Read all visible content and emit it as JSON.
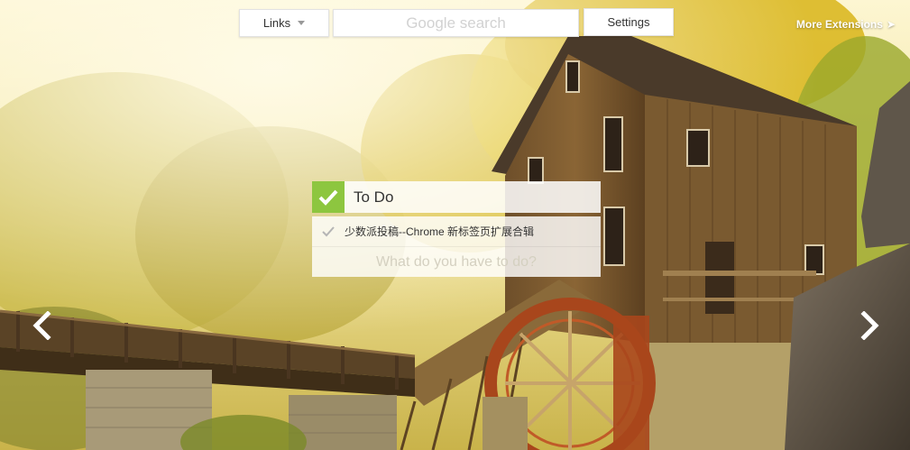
{
  "header": {
    "links_label": "Links",
    "search_placeholder": "Google search",
    "settings_label": "Settings",
    "more_extensions_label": "More Extensions",
    "more_extensions_icon": "arrow-right-icon"
  },
  "carousel": {
    "prev_icon": "chevron-left-icon",
    "next_icon": "chevron-right-icon"
  },
  "todo": {
    "title": "To Do",
    "title_icon": "checkmark-icon",
    "accent_color": "#8dc63f",
    "items": [
      {
        "text": "少数派投稿--Chrome 新标签页扩展合辑",
        "done": true
      }
    ],
    "new_item_placeholder": "What do you have to do?"
  },
  "background": {
    "description_icon": "wallpaper-image"
  }
}
